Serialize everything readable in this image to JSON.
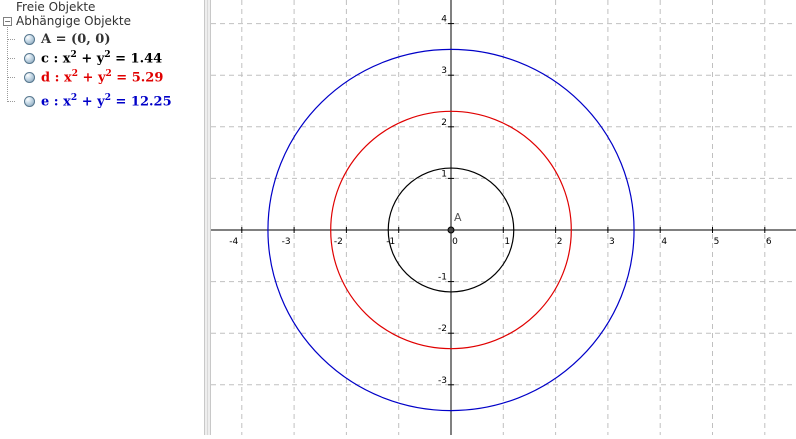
{
  "algebra": {
    "free_objects_label": "Freie Objekte",
    "dependent_objects_label": "Abhängige Objekte",
    "items": [
      {
        "name": "A",
        "sep": " = ",
        "def": "(0, 0)",
        "color": "#333333"
      },
      {
        "name": "c",
        "sep": " : ",
        "lhs_x": "x",
        "lhs_y": "y",
        "exp": "2",
        "rhs": "1.44",
        "color": "#000000"
      },
      {
        "name": "d",
        "sep": " : ",
        "lhs_x": "x",
        "lhs_y": "y",
        "exp": "2",
        "rhs": "5.29",
        "color": "#e00000"
      },
      {
        "name": "e",
        "sep": " : ",
        "lhs_x": "x",
        "lhs_y": "y",
        "exp": "2",
        "rhs": "12.25",
        "color": "#0000c8"
      }
    ]
  },
  "graphics": {
    "point": {
      "label": "A",
      "x": 0,
      "y": 0
    },
    "circles": [
      {
        "name": "c",
        "radius_squared": 1.44,
        "color": "#000000"
      },
      {
        "name": "d",
        "radius_squared": 5.29,
        "color": "#e00000"
      },
      {
        "name": "e",
        "radius_squared": 12.25,
        "color": "#0000c8"
      }
    ],
    "x_ticks": [
      "-4",
      "-3",
      "-2",
      "-1",
      "0",
      "1",
      "2",
      "3",
      "4",
      "5",
      "6"
    ],
    "y_ticks": [
      "4",
      "3",
      "2",
      "1",
      "-1",
      "-2",
      "-3"
    ],
    "grid_color": "#c0c0c0"
  }
}
